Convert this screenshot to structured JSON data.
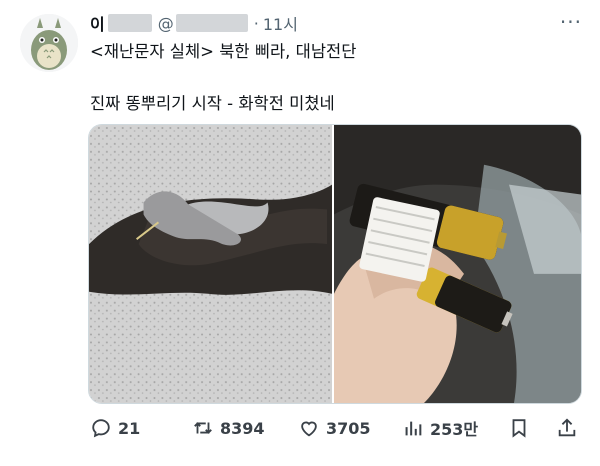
{
  "tweet": {
    "author_name_prefix": "이",
    "handle_prefix": "@",
    "separator": "·",
    "time": "11시",
    "more": "···",
    "line1": "<재난문자 실체> 북한 삐라, 대남전단",
    "line2": "진짜 똥뿌리기 시작 - 화학전 미쳤네"
  },
  "media": {
    "photo1_icon": "leaflet-balloon-on-ground",
    "photo2_icon": "hand-holding-batteries"
  },
  "actions": {
    "reply_count": "21",
    "retweet_count": "8394",
    "like_count": "3705",
    "views_count": "253만"
  },
  "colors": {
    "text": "#0f1419",
    "secondary": "#536471",
    "icon": "#3a4148"
  }
}
